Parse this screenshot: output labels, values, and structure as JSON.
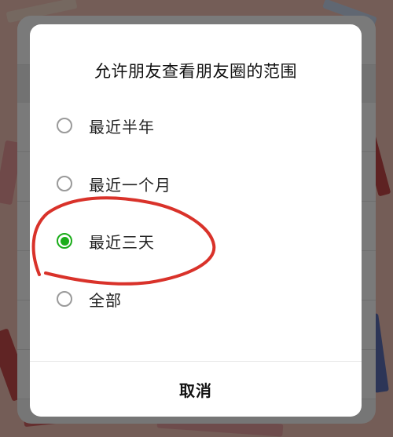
{
  "dialog": {
    "title": "允许朋友查看朋友圈的范围",
    "options": [
      {
        "label": "最近半年",
        "checked": false
      },
      {
        "label": "最近一个月",
        "checked": false
      },
      {
        "label": "最近三天",
        "checked": true
      },
      {
        "label": "全部",
        "checked": false
      }
    ],
    "cancel_label": "取消"
  },
  "colors": {
    "accent": "#1aad19",
    "annotation": "#d9322a"
  }
}
